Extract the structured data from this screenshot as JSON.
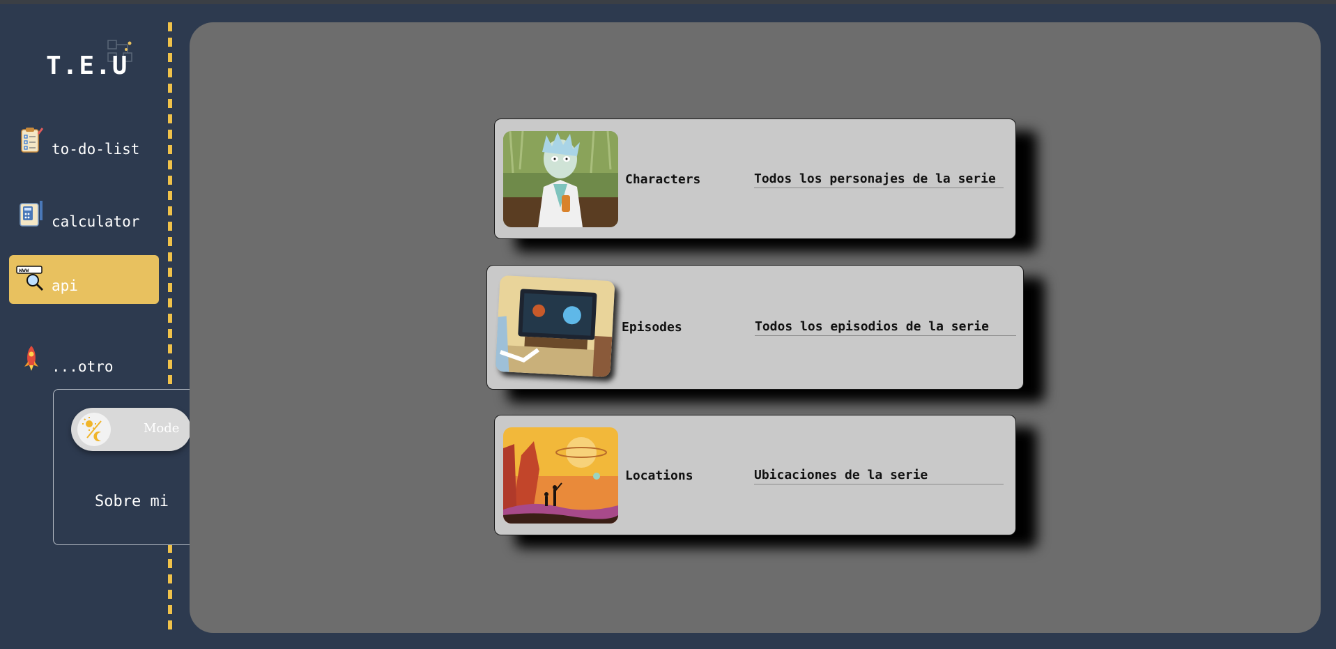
{
  "app": {
    "logo": "T.E.U"
  },
  "sidebar": {
    "items": [
      {
        "label": "to-do-list",
        "icon": "checklist-icon"
      },
      {
        "label": "calculator",
        "icon": "calculator-icon"
      },
      {
        "label": "api",
        "icon": "www-search-icon",
        "active": true
      },
      {
        "label": "...otro",
        "icon": "rocket-icon"
      }
    ]
  },
  "settings_panel": {
    "mode_label": "Mode",
    "mode_icon": "sun-moon-icon",
    "about_label": "Sobre mi"
  },
  "cards": [
    {
      "title": "Characters",
      "description": "Todos los personajes de la serie",
      "image": "rick-portrait-image"
    },
    {
      "title": "Episodes",
      "description": "Todos los episodios de la serie",
      "image": "tv-episode-image"
    },
    {
      "title": "Locations",
      "description": "Ubicaciones de la serie",
      "image": "alien-landscape-image"
    }
  ],
  "colors": {
    "background": "#2d3a4f",
    "accent": "#e8c15f",
    "rail": "#f0c24a",
    "main_panel": "#6d6d6d",
    "card": "#c9c9c9"
  }
}
